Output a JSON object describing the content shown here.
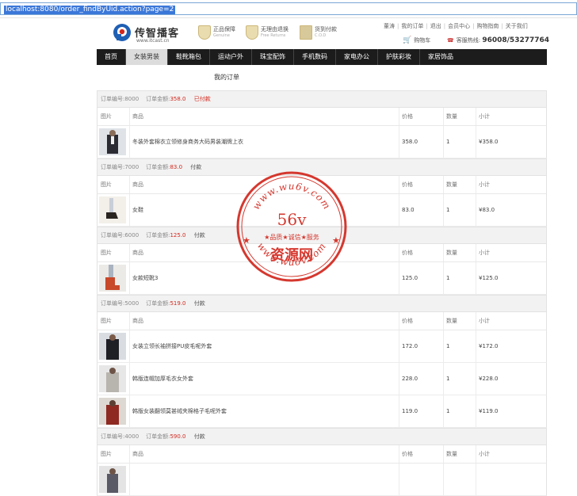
{
  "browser": {
    "url": "localhost:8080/order_findByUid.action?page=2"
  },
  "header": {
    "logo": {
      "name": "传智播客",
      "url": "www.itcast.cn"
    },
    "badges": [
      {
        "title": "正品保障",
        "sub": "Genuine"
      },
      {
        "title": "无理由退换",
        "sub": "Free Returns"
      },
      {
        "title": "货到付款",
        "sub": "C.O.D"
      }
    ],
    "links": [
      "董涛",
      "我的订单",
      "退出",
      "会员中心",
      "购物指南",
      "关于我们"
    ],
    "cart": "购物车",
    "hotline_label": "客服热线:",
    "hotline_number": "96008/53277764"
  },
  "nav": [
    "首页",
    "女装男装",
    "鞋靴箱包",
    "运动户外",
    "珠宝配饰",
    "手机数码",
    "家电办公",
    "护肤彩妆",
    "家居饰品"
  ],
  "page_title": "我的订单",
  "columns": {
    "img": "图片",
    "product": "商品",
    "price": "价格",
    "qty": "数量",
    "subtotal": "小计"
  },
  "orders": [
    {
      "id_label": "订单编号:8000",
      "amount_label": "订单金额:",
      "amount": "358.0",
      "status": "已付款",
      "items": [
        {
          "name": "冬装外套棉衣立领修身商务大码男装潮牌上衣",
          "price": "358.0",
          "qty": "1",
          "subtotal": "¥358.0"
        }
      ]
    },
    {
      "id_label": "订单编号:7000",
      "amount_label": "订单金额:",
      "amount": "83.0",
      "status": "付款",
      "items": [
        {
          "name": "女鞋",
          "price": "83.0",
          "qty": "1",
          "subtotal": "¥83.0"
        }
      ]
    },
    {
      "id_label": "订单编号:6000",
      "amount_label": "订单金额:",
      "amount": "125.0",
      "status": "付款",
      "items": [
        {
          "name": "女款短靴3",
          "price": "125.0",
          "qty": "1",
          "subtotal": "¥125.0"
        }
      ]
    },
    {
      "id_label": "订单编号:5000",
      "amount_label": "订单金额:",
      "amount": "519.0",
      "status": "付款",
      "items": [
        {
          "name": "女装立领长袖拼接PU皮毛呢外套",
          "price": "172.0",
          "qty": "1",
          "subtotal": "¥172.0"
        },
        {
          "name": "韩版连帽加厚毛衣女外套",
          "price": "228.0",
          "qty": "1",
          "subtotal": "¥228.0"
        },
        {
          "name": "韩版女装翻领莫甚绒夹棉格子毛呢外套",
          "price": "119.0",
          "qty": "1",
          "subtotal": "¥119.0"
        }
      ]
    },
    {
      "id_label": "订单编号:4000",
      "amount_label": "订单金额:",
      "amount": "590.0",
      "status": "付款",
      "items": [
        {
          "name": "",
          "price": "",
          "qty": "",
          "subtotal": ""
        }
      ]
    }
  ],
  "watermark": {
    "arc_top": "www.wu6v.com",
    "center": "56v",
    "tagline": "★品质★诚信★服务",
    "main": "资源网",
    "arc_bottom": "www.wu6v.com"
  },
  "colors": {
    "nav_bg": "#1c1c1c",
    "accent_red": "#d2281e",
    "link_blue": "#3b77d9"
  }
}
